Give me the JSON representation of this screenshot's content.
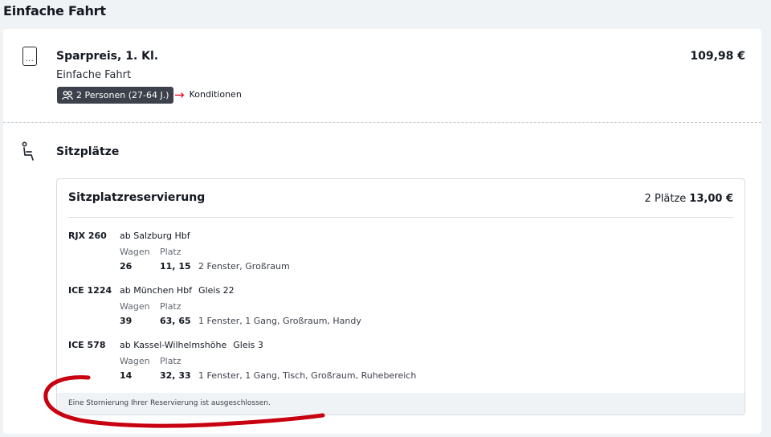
{
  "page": {
    "heading": "Einfache Fahrt"
  },
  "offer": {
    "ticket_icon_glyph": "...",
    "title": "Sparpreis, 1. Kl.",
    "subtitle": "Einfache Fahrt",
    "persons_badge": "2 Personen (27-64 J.)",
    "conditions_link": "Konditionen",
    "price": "109,98 €"
  },
  "seats": {
    "title": "Sitzplätze",
    "reservation": {
      "title": "Sitzplatzreservierung",
      "count": "2 Plätze",
      "price": "13,00 €",
      "wagen_label": "Wagen",
      "platz_label": "Platz",
      "legs": [
        {
          "train": "RJX 260",
          "from": "ab Salzburg Hbf",
          "gleis": "",
          "wagen": "26",
          "platz": "11, 15",
          "details": "2 Fenster, Großraum"
        },
        {
          "train": "ICE 1224",
          "from": "ab München Hbf",
          "gleis": "Gleis 22",
          "wagen": "39",
          "platz": "63, 65",
          "details": "1 Fenster, 1 Gang, Großraum, Handy"
        },
        {
          "train": "ICE 578",
          "from": "ab Kassel-Wilhelmshöhe",
          "gleis": "Gleis 3",
          "wagen": "14",
          "platz": "32, 33",
          "details": "1 Fenster, 1 Gang, Tisch, Großraum, Ruhebereich"
        }
      ],
      "footer_note": "Eine Stornierung Ihrer Reservierung ist ausgeschlossen."
    }
  },
  "icons": {
    "ticket": "smartphone-ticket-icon",
    "persons": "persons-icon",
    "arrow": "arrow-right-icon",
    "seat": "seat-icon"
  },
  "colors": {
    "accent_red": "#ec0016",
    "badge_bg": "#3c414b",
    "annotation_red": "#c8000f"
  }
}
